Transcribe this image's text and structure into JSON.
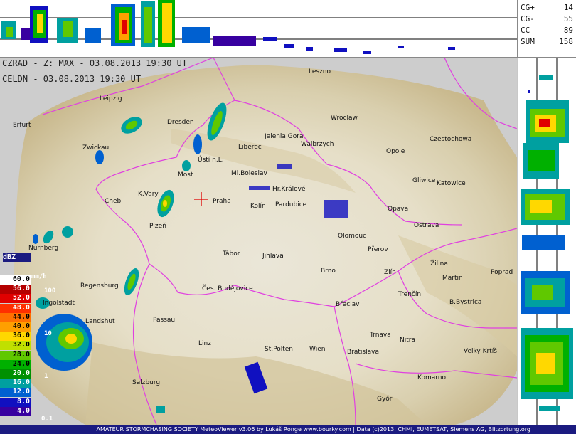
{
  "header": {
    "line1": "CZRAD - Z: MAX - 03.08.2013 19:30 UT",
    "line2": "CELDN - 03.08.2013 19:30 UT"
  },
  "lightning_stats": [
    {
      "key": "CG+",
      "value": "14"
    },
    {
      "key": "CG-",
      "value": "55"
    },
    {
      "key": "CC",
      "value": "89"
    },
    {
      "key": "SUM",
      "value": "158"
    }
  ],
  "legend": {
    "unit_dbz": "dBZ",
    "unit_mmh": "mm/h",
    "levels": [
      {
        "label": "60.0",
        "color": "#ffffff",
        "text": "#000000"
      },
      {
        "label": "56.0",
        "color": "#b40000",
        "text": "#ffffff"
      },
      {
        "label": "52.0",
        "color": "#e00000",
        "text": "#ffffff"
      },
      {
        "label": "48.0",
        "color": "#ff3000",
        "text": "#ffffff"
      },
      {
        "label": "44.0",
        "color": "#ff7000",
        "text": "#000000"
      },
      {
        "label": "40.0",
        "color": "#ffa000",
        "text": "#000000"
      },
      {
        "label": "36.0",
        "color": "#ffd800",
        "text": "#000000"
      },
      {
        "label": "32.0",
        "color": "#c0e000",
        "text": "#000000"
      },
      {
        "label": "28.0",
        "color": "#60c800",
        "text": "#000000"
      },
      {
        "label": "24.0",
        "color": "#00b000",
        "text": "#000000"
      },
      {
        "label": "20.0",
        "color": "#009000",
        "text": "#ffffff"
      },
      {
        "label": "16.0",
        "color": "#00a0a0",
        "text": "#ffffff"
      },
      {
        "label": "12.0",
        "color": "#0060d0",
        "text": "#ffffff"
      },
      {
        "label": "8.0",
        "color": "#1010c0",
        "text": "#ffffff"
      },
      {
        "label": "4.0",
        "color": "#3800a0",
        "text": "#ffffff"
      }
    ],
    "rain_labels": [
      "100",
      "10",
      "1",
      "0.1"
    ]
  },
  "cities": [
    {
      "name": "Leszno",
      "big": true
    },
    {
      "name": "Leipzig",
      "big": true
    },
    {
      "name": "Dresden",
      "big": true
    },
    {
      "name": "Wroclaw",
      "big": true
    },
    {
      "name": "Jelenia Gora",
      "big": false
    },
    {
      "name": "Liberec",
      "big": false
    },
    {
      "name": "Walbrzych",
      "big": false
    },
    {
      "name": "Czestochowa",
      "big": true
    },
    {
      "name": "Opole",
      "big": false
    },
    {
      "name": "Erfurt",
      "big": true
    },
    {
      "name": "Zwickau",
      "big": true
    },
    {
      "name": "Ústí n.L.",
      "big": false
    },
    {
      "name": "Most",
      "big": false
    },
    {
      "name": "Ml.Boleslav",
      "big": false
    },
    {
      "name": "Gliwice",
      "big": true
    },
    {
      "name": "Katowice",
      "big": true
    },
    {
      "name": "K.Vary",
      "big": true
    },
    {
      "name": "Hr.Králové",
      "big": false
    },
    {
      "name": "Praha",
      "big": true
    },
    {
      "name": "Cheb",
      "big": false
    },
    {
      "name": "Kolín",
      "big": false
    },
    {
      "name": "Pardubice",
      "big": false
    },
    {
      "name": "Opava",
      "big": false
    },
    {
      "name": "Ostrava",
      "big": false
    },
    {
      "name": "Plzeň",
      "big": true
    },
    {
      "name": "Olomouc",
      "big": true
    },
    {
      "name": "Přerov",
      "big": false
    },
    {
      "name": "Nürnberg",
      "big": true
    },
    {
      "name": "Tábor",
      "big": false
    },
    {
      "name": "Jihlava",
      "big": true
    },
    {
      "name": "Žilina",
      "big": true
    },
    {
      "name": "Martin",
      "big": false
    },
    {
      "name": "Poprad",
      "big": true
    },
    {
      "name": "Brno",
      "big": true
    },
    {
      "name": "Zlín",
      "big": true
    },
    {
      "name": "Regensburg",
      "big": true
    },
    {
      "name": "Čes. Budějovice",
      "big": true
    },
    {
      "name": "Trenčín",
      "big": true
    },
    {
      "name": "Ingolstadt",
      "big": false
    },
    {
      "name": "Břeclav",
      "big": false
    },
    {
      "name": "B.Bystrica",
      "big": true
    },
    {
      "name": "Passau",
      "big": true
    },
    {
      "name": "Landshut",
      "big": false
    },
    {
      "name": "Trnava",
      "big": true
    },
    {
      "name": "Nitra",
      "big": true
    },
    {
      "name": "Linz",
      "big": true
    },
    {
      "name": "St.Polten",
      "big": true
    },
    {
      "name": "Wien",
      "big": true
    },
    {
      "name": "Bratislava",
      "big": true
    },
    {
      "name": "Velky Krtíš",
      "big": true
    },
    {
      "name": "Komarno",
      "big": true
    },
    {
      "name": "Salzburg",
      "big": true
    },
    {
      "name": "Győr",
      "big": true
    }
  ],
  "footer": {
    "text": "AMATEUR STORMCHASING SOCIETY MeteoViewer v3.06 by Lukáš Ronge www.bourky.com | Data (c)2013: CHMI, EUMETSAT, Siemens AG, Blitzortung.org"
  }
}
